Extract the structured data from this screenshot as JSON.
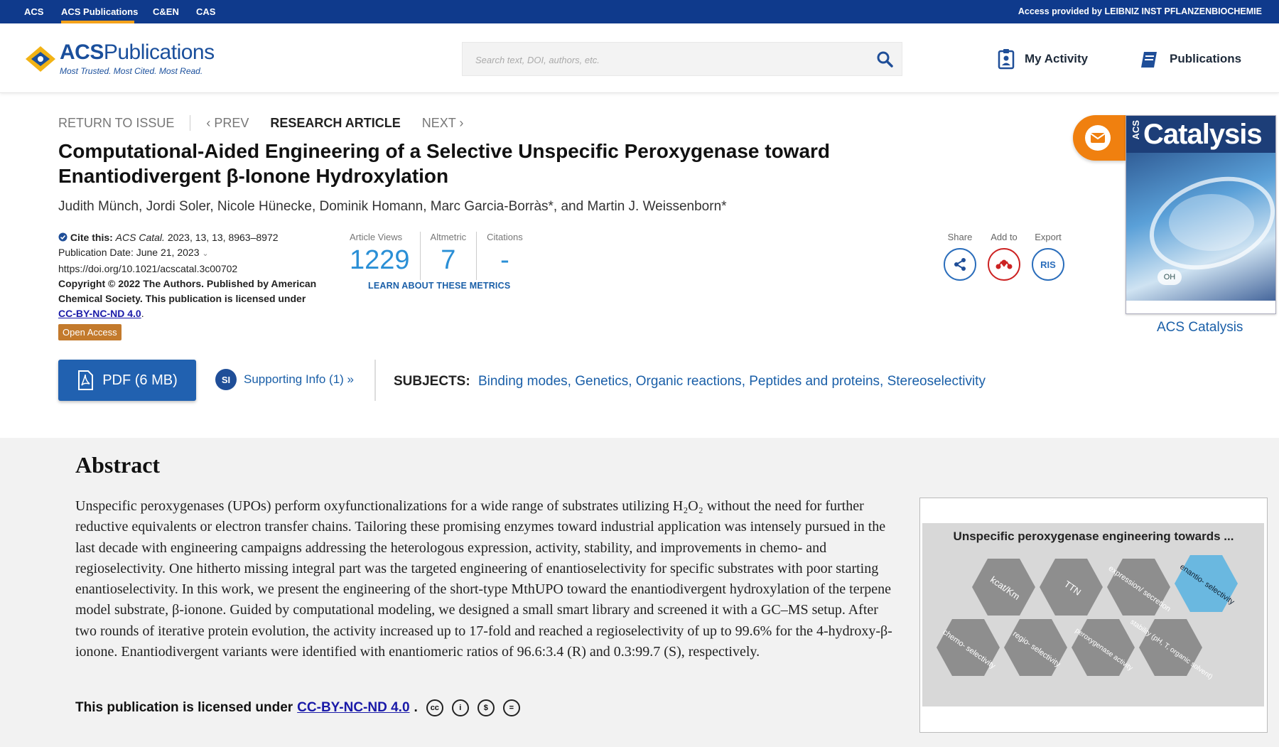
{
  "topbar": {
    "links": [
      "ACS",
      "ACS Publications",
      "C&EN",
      "CAS"
    ],
    "access": "Access provided by LEIBNIZ INST PFLANZENBIOCHEMIE"
  },
  "header": {
    "logo_main": "ACS",
    "logo_sub": "Publications",
    "tagline": "Most Trusted. Most Cited. Most Read.",
    "search_placeholder": "Search text, DOI, authors, etc.",
    "my_activity": "My Activity",
    "publications": "Publications"
  },
  "nav": {
    "return": "RETURN TO ISSUE",
    "prev": "‹ PREV",
    "current": "RESEARCH ARTICLE",
    "next": "NEXT ›"
  },
  "article": {
    "title": "Computational-Aided Engineering of a Selective Unspecific Peroxygenase toward Enantiodivergent β-Ionone Hydroxylation",
    "authors": "Judith Münch, Jordi Soler, Nicole Hünecke, Dominik Homann, Marc Garcia-Borràs*, and Martin J. Weissenborn*",
    "cite_label": "Cite this:",
    "cite_journal": "ACS Catal.",
    "cite_ref": "2023, 13, 13, 8963–8972",
    "pub_date": "Publication Date: June 21, 2023",
    "doi": "https://doi.org/10.1021/acscatal.3c00702",
    "copyright": "Copyright © 2022 The Authors. Published by American Chemical Society. This publication is licensed under",
    "license_link": "CC-BY-NC-ND 4.0",
    "open_access": "Open Access"
  },
  "metrics": {
    "views_label": "Article Views",
    "views": "1229",
    "altmetric_label": "Altmetric",
    "altmetric": "7",
    "citations_label": "Citations",
    "citations": "-",
    "learn": "LEARN ABOUT THESE METRICS"
  },
  "actions": {
    "share": "Share",
    "add_to": "Add to",
    "export": "Export",
    "ris": "RIS"
  },
  "cover": {
    "acs": "ACS",
    "title": "Catalysis",
    "label": "ACS Catalysis"
  },
  "buttons": {
    "pdf": "PDF (6 MB)",
    "si_badge": "SI",
    "si": "Supporting Info (1) »"
  },
  "subjects": {
    "label": "SUBJECTS:",
    "items": [
      "Binding modes",
      "Genetics",
      "Organic reactions",
      "Peptides and proteins",
      "Stereoselectivity"
    ]
  },
  "abstract": {
    "heading": "Abstract",
    "text": "Unspecific peroxygenases (UPOs) perform oxyfunctionalizations for a wide range of substrates utilizing H₂O₂ without the need for further reductive equivalents or electron transfer chains. Tailoring these promising enzymes toward industrial application was intensely pursued in the last decade with engineering campaigns addressing the heterologous expression, activity, stability, and improvements in chemo- and regioselectivity. One hitherto missing integral part was the targeted engineering of enantioselectivity for specific substrates with poor starting enantioselectivity. In this work, we present the engineering of the short-type MthUPO toward the enantiodivergent hydroxylation of the terpene model substrate, β-ionone. Guided by computational modeling, we designed a small smart library and screened it with a GC–MS setup. After two rounds of iterative protein evolution, the activity increased up to 17-fold and reached a regioselectivity of up to 99.6% for the 4-hydroxy-β-ionone. Enantiodivergent variants were identified with enantiomeric ratios of 96.6:3.4 (R) and 0.3:99.7 (S), respectively.",
    "license_text": "This publication is licensed under",
    "license_link": "CC-BY-NC-ND 4.0",
    "toc_title": "Unspecific peroxygenase engineering towards ...",
    "toc_pieces": [
      "kcat/Km",
      "TTN",
      "expression/ secretion",
      "enantio- selectivity",
      "chemo- selectivity",
      "regio- selectivity",
      "peroxygenase activity",
      "stability (pH, T, organic solvent)"
    ]
  },
  "colors": {
    "topbar": "#0f3a8c",
    "accent_orange": "#f0800f",
    "link_blue": "#1a5fa8",
    "metric_blue": "#2a8fd6",
    "pdf_button": "#2161b0"
  }
}
